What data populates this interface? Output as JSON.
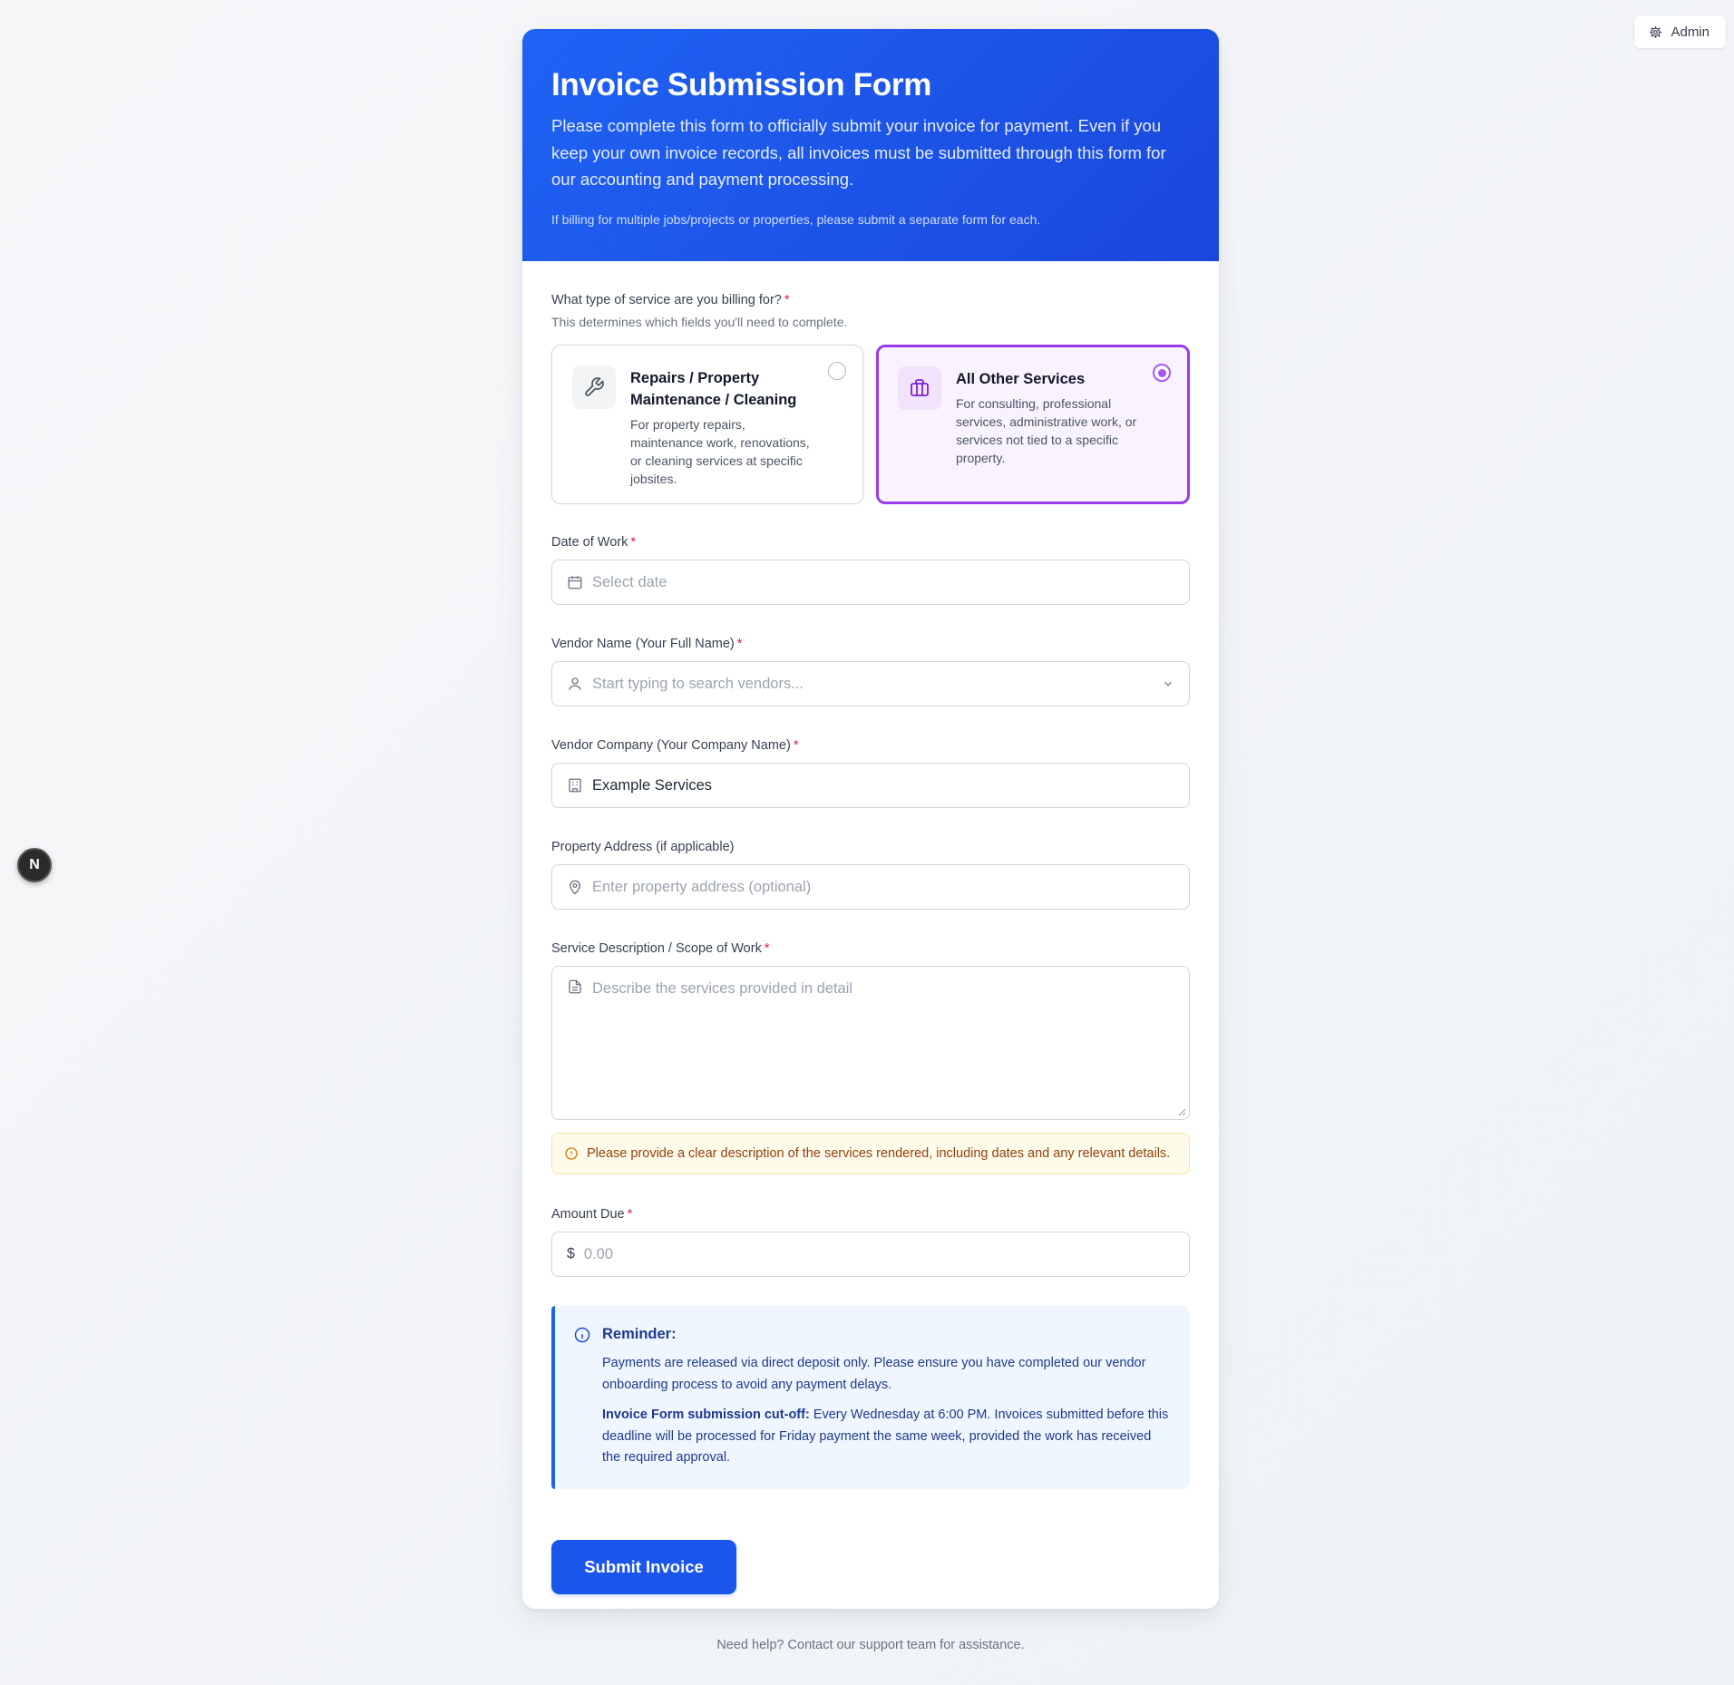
{
  "admin": {
    "label": "Admin",
    "icon": "gear-icon"
  },
  "badge": {
    "letter": "N"
  },
  "header": {
    "title": "Invoice Submission Form",
    "lead": "Please complete this form to officially submit your invoice for payment. Even if you keep your own invoice records, all invoices must be submitted through this form for our accounting and payment processing.",
    "note": "If billing for multiple jobs/projects or properties, please submit a separate form for each."
  },
  "service": {
    "question": "What type of service are you billing for?",
    "helper": "This determines which fields you'll need to complete.",
    "selected": "other",
    "options": [
      {
        "title": "Repairs / Property Maintenance / Cleaning",
        "desc": "For property repairs, maintenance work, renovations, or cleaning services at specific jobsites.",
        "icon": "wrench-icon"
      },
      {
        "title": "All Other Services",
        "desc": "For consulting, professional services, administrative work, or services not tied to a specific property.",
        "icon": "briefcase-icon"
      }
    ]
  },
  "fields": {
    "date": {
      "label": "Date of Work",
      "placeholder": "Select date",
      "icon": "calendar-icon"
    },
    "vendor_name": {
      "label": "Vendor Name (Your Full Name)",
      "placeholder": "Start typing to search vendors...",
      "icon": "user-icon"
    },
    "vendor_company": {
      "label": "Vendor Company (Your Company Name)",
      "value": "Example Services",
      "icon": "building-icon"
    },
    "property": {
      "label": "Property Address (if applicable)",
      "placeholder": "Enter property address (optional)",
      "icon": "map-pin-icon"
    },
    "description": {
      "label": "Service Description / Scope of Work",
      "placeholder": "Describe the services provided in detail",
      "icon": "document-icon"
    },
    "amount": {
      "label": "Amount Due",
      "currency": "$",
      "placeholder": "0.00"
    }
  },
  "required_mark": "*",
  "warning": "Please provide a clear description of the services rendered, including dates and any relevant details.",
  "reminder": {
    "title": "Reminder:",
    "p1": "Payments are released via direct deposit only. Please ensure you have completed our vendor onboarding process to avoid any payment delays.",
    "p2_bold": "Invoice Form submission cut-off:",
    "p2_rest": " Every Wednesday at 6:00 PM. Invoices submitted before this deadline will be processed for Friday payment the same week, provided the work has received the required approval."
  },
  "submit_label": "Submit Invoice",
  "footer": "Need help? Contact our support team for assistance.",
  "colors": {
    "primary": "#1a55ec",
    "selected_border": "#9a3ce6",
    "required": "#e11d48"
  }
}
